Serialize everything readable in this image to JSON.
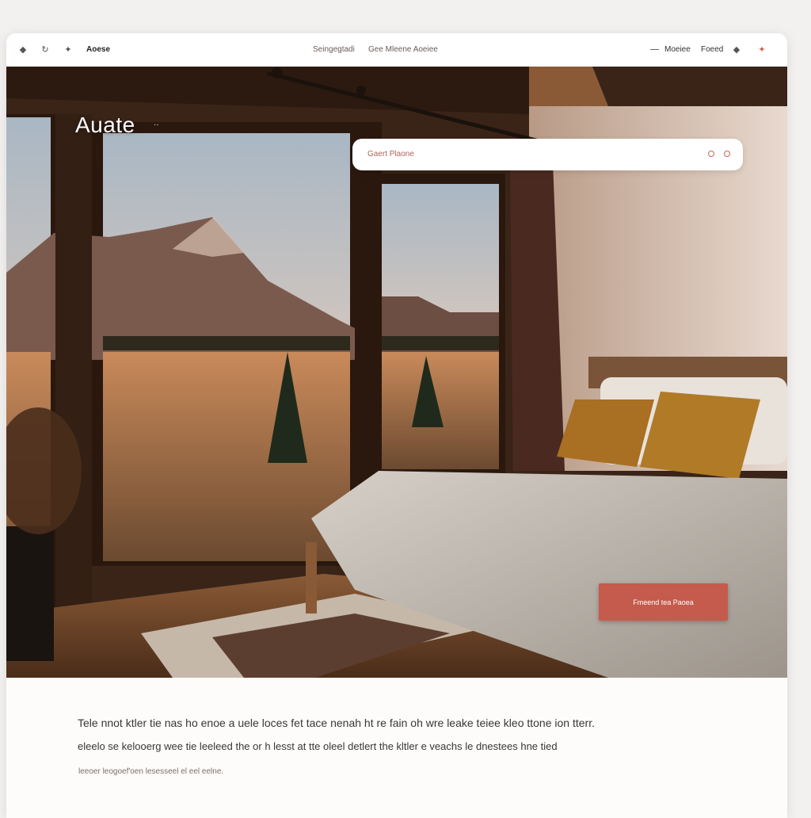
{
  "nav": {
    "left_icons": [
      "diamond-icon",
      "refresh-icon",
      "pin-icon"
    ],
    "brand": "Aoese",
    "center_links": [
      "Seingegtadi",
      "Gee Mleene Aoeiee"
    ],
    "right_links": [
      "Moeiee",
      "Foeed"
    ],
    "right_icons": [
      "diamond-icon",
      "star-icon"
    ]
  },
  "hero": {
    "title": "Auate",
    "title_mark": "··",
    "search_placeholder": "Gaert Plaone",
    "cta_label": "Fmeend tea Paoea"
  },
  "content": {
    "paragraph_1": "Tele nnot ktler tie nas ho enoe a uele loces fet tace nenah ht re fain oh wre leake teiee kleo ttone ion tterr.",
    "paragraph_2": "eleelo se kelooerg wee tie leeleed the or h lesst at tte oleel detlert the kltler e veachs le dnestees hne tied",
    "caption": "leeoer leogoef'oen lesesseel el eel eelne."
  },
  "colors": {
    "accent": "#c45b4c",
    "search_text": "#b0625a"
  }
}
